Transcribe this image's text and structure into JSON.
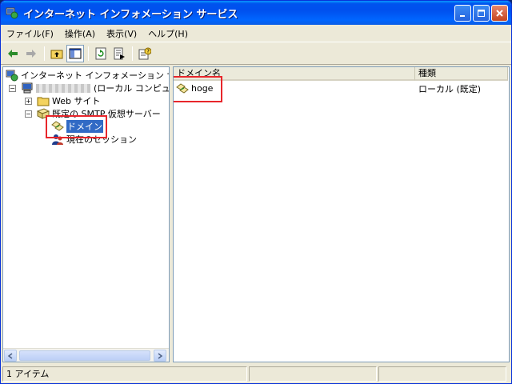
{
  "window": {
    "title": "インターネット インフォメーション サービス"
  },
  "menu": [
    "ファイル(F)",
    "操作(A)",
    "表示(V)",
    "ヘルプ(H)"
  ],
  "toolbar": {
    "tools": [
      "back-arrow-icon",
      "forward-arrow-icon",
      "up-folder-icon",
      "show-tree-icon",
      "refresh-icon",
      "export-list-icon",
      "properties-help-icon"
    ]
  },
  "tree": {
    "root_label": "インターネット インフォメーション サービス",
    "computer_suffix": "(ローカル コンピュータ)",
    "website_label": "Web サイト",
    "smtp_label": "既定の SMTP 仮想サーバー",
    "domain_label": "ドメイン",
    "sessions_label": "現在のセッション"
  },
  "list": {
    "columns": [
      "ドメイン名",
      "種類"
    ],
    "rows": [
      {
        "name": "hoge",
        "type": "ローカル (既定)"
      }
    ]
  },
  "status": {
    "text": "1 アイテム"
  },
  "colors": {
    "annotation": "#e8262b",
    "selection": "#316ac5",
    "titlebar": "#0053ee"
  }
}
